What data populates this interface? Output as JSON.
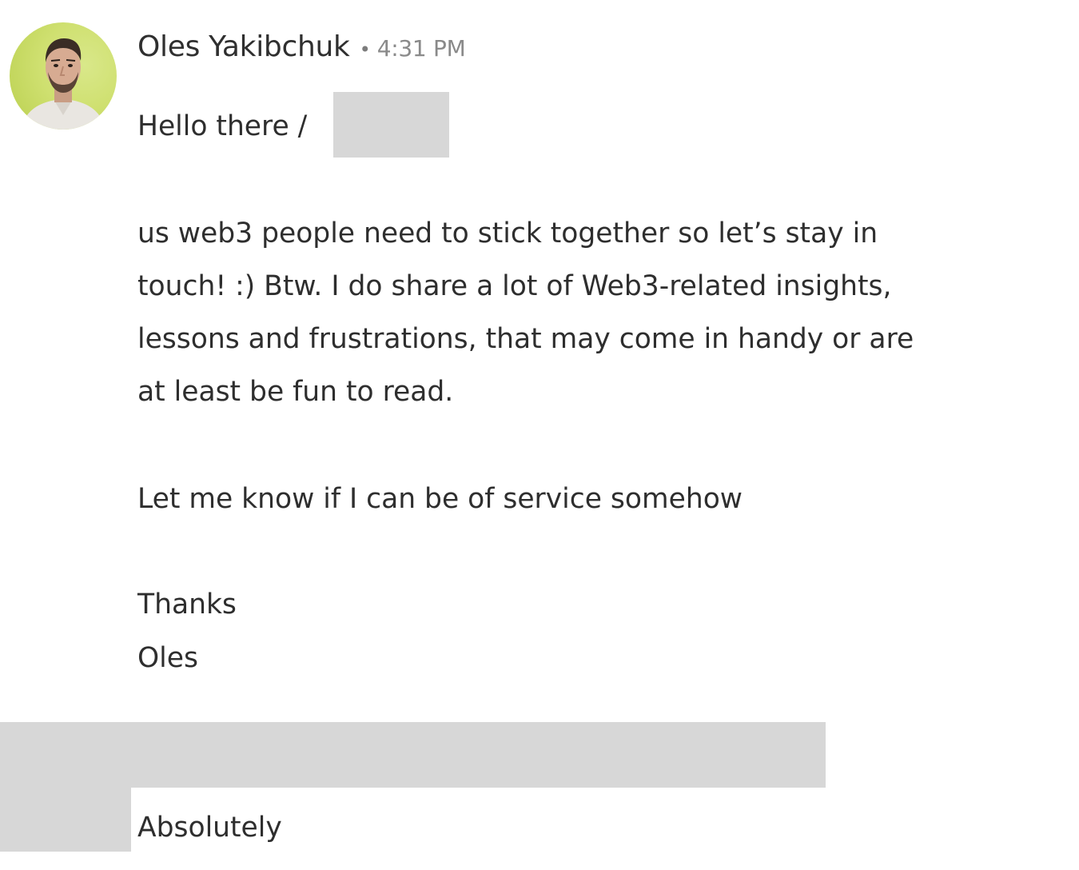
{
  "message": {
    "sender": {
      "name": "Oles Yakibchuk",
      "avatar_icon": "profile-photo"
    },
    "separator": "•",
    "timestamp": "4:31 PM",
    "greeting": "Hello there /",
    "body_lines": [
      "us web3 people need to stick together so let’s stay in",
      "touch! :) Btw. I do share a lot of Web3-related insights,",
      "lessons and frustrations, that may come in handy or are",
      "at least be fun to read."
    ],
    "closing": "Let me know if I can be of service somehow",
    "thanks": "Thanks",
    "signature": "Oles"
  },
  "reply": {
    "text": "Absolutely"
  },
  "colors": {
    "avatar_background": "#cfe070",
    "redaction": "#d7d7d7",
    "text": "#2e2e2e",
    "timestamp": "#8a8a8a"
  }
}
